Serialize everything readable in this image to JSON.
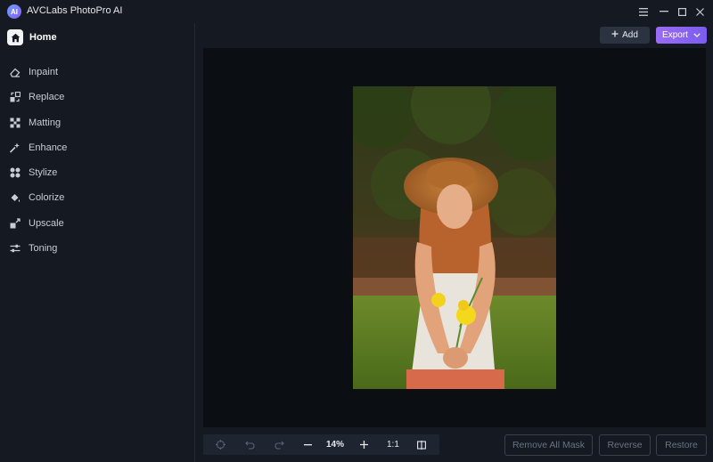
{
  "app": {
    "title": "AVCLabs PhotoPro AI",
    "logo_text": "AI"
  },
  "window": {
    "menu_icon": "hamburger-icon",
    "minimize_icon": "minimize-icon",
    "maximize_icon": "maximize-icon",
    "close_icon": "close-icon"
  },
  "sidebar": {
    "home": "Home",
    "items": [
      {
        "label": "Inpaint",
        "icon": "eraser-icon"
      },
      {
        "label": "Replace",
        "icon": "replace-icon"
      },
      {
        "label": "Matting",
        "icon": "matting-icon"
      },
      {
        "label": "Enhance",
        "icon": "enhance-icon"
      },
      {
        "label": "Stylize",
        "icon": "stylize-icon"
      },
      {
        "label": "Colorize",
        "icon": "colorize-icon"
      },
      {
        "label": "Upscale",
        "icon": "upscale-icon"
      },
      {
        "label": "Toning",
        "icon": "toning-icon"
      }
    ]
  },
  "header": {
    "add_label": "Add",
    "export_label": "Export"
  },
  "toolbar": {
    "zoom": "14%",
    "ratio": "1:1"
  },
  "actions": {
    "remove_all_mask": "Remove All Mask",
    "reverse": "Reverse",
    "restore": "Restore"
  },
  "colors": {
    "accent": "#8a62f2",
    "background": "#151a22",
    "canvas": "#0b0f14"
  }
}
